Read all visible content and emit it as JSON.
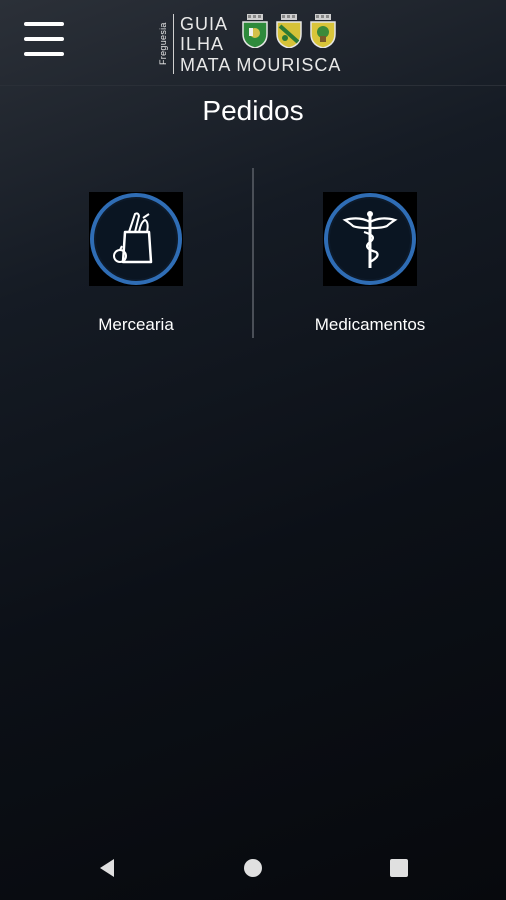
{
  "header": {
    "menu_icon": "hamburger-menu-icon",
    "logo": {
      "vertical_text": "Freguesia",
      "line1": "GUIA",
      "line2": "ILHA",
      "line3": "MATA MOURISCA",
      "crests": [
        "coat-of-arms-guia",
        "coat-of-arms-ilha",
        "coat-of-arms-mata-mourisca"
      ]
    }
  },
  "page": {
    "title": "Pedidos"
  },
  "options": [
    {
      "label": "Mercearia",
      "icon": "grocery-bag-icon"
    },
    {
      "label": "Medicamentos",
      "icon": "caduceus-icon"
    }
  ],
  "navbar": {
    "back_icon": "back-triangle-icon",
    "home_icon": "home-circle-icon",
    "recents_icon": "recents-square-icon"
  },
  "colors": {
    "accent_ring": "#2f6db5",
    "background_top": "#2b3038",
    "background_bottom": "#07090d"
  }
}
